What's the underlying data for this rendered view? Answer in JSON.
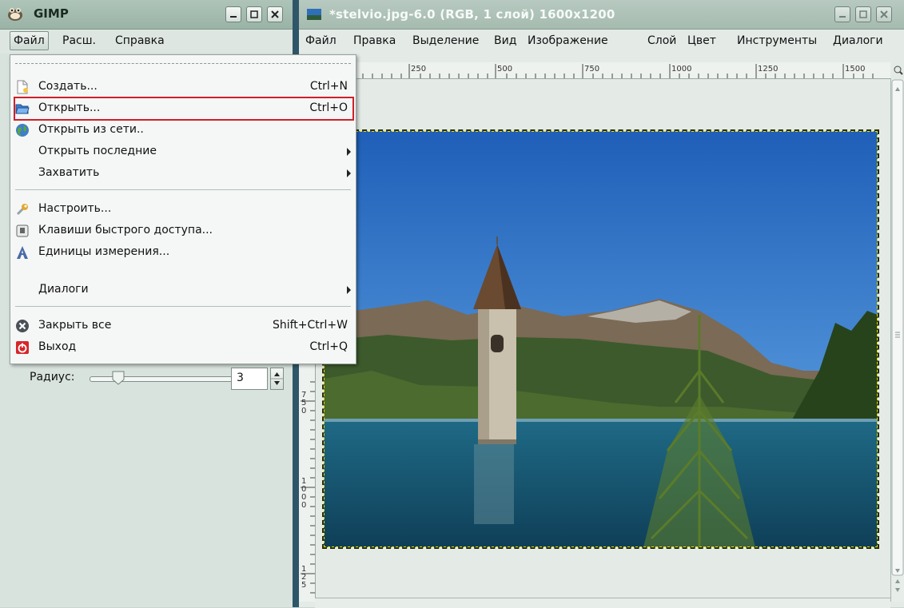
{
  "toolbox": {
    "title": "GIMP",
    "menu": [
      {
        "label": "Файл",
        "active": true
      },
      {
        "label": "Расш."
      },
      {
        "label": "Справка"
      }
    ],
    "radius_label": "Радиус:",
    "radius_value": "3"
  },
  "image_window": {
    "title": "*stelvio.jpg-6.0 (RGB, 1 слой) 1600x1200",
    "menu": [
      "Файл",
      "Правка",
      "Выделение",
      "Вид",
      "Изображение",
      "Слой",
      "Цвет",
      "Инструменты",
      "Диалоги"
    ],
    "ruler_h": [
      "250",
      "500",
      "750",
      "1000",
      "1250",
      "1500"
    ],
    "ruler_v": [
      "750",
      "1000",
      "125"
    ]
  },
  "file_menu": {
    "items": [
      {
        "label": "Создать...",
        "accel": "Ctrl+N",
        "icon": "new-document-icon"
      },
      {
        "label": "Открыть...",
        "accel": "Ctrl+O",
        "icon": "open-folder-icon",
        "highlighted": true
      },
      {
        "label": "Открыть из сети..",
        "accel": "",
        "icon": "globe-icon"
      },
      {
        "label": "Открыть последние",
        "submenu": true
      },
      {
        "label": "Захватить",
        "submenu": true
      },
      {
        "label": "Настроить...",
        "accel": "",
        "icon": "wrench-icon"
      },
      {
        "label": "Клавиши быстрого доступа...",
        "accel": "",
        "icon": "keyboard-key-icon"
      },
      {
        "label": "Единицы измерения...",
        "accel": "",
        "icon": "ruler-units-icon"
      },
      {
        "label": "Диалоги",
        "submenu": true
      },
      {
        "label": "Закрыть все",
        "accel": "Shift+Ctrl+W",
        "icon": "close-all-icon"
      },
      {
        "label": "Выход",
        "accel": "Ctrl+Q",
        "icon": "quit-icon"
      }
    ]
  },
  "colors": {
    "highlight_border": "#d0202a",
    "title_bar": "#9ab3a7",
    "window_separator": "#2e5668"
  }
}
